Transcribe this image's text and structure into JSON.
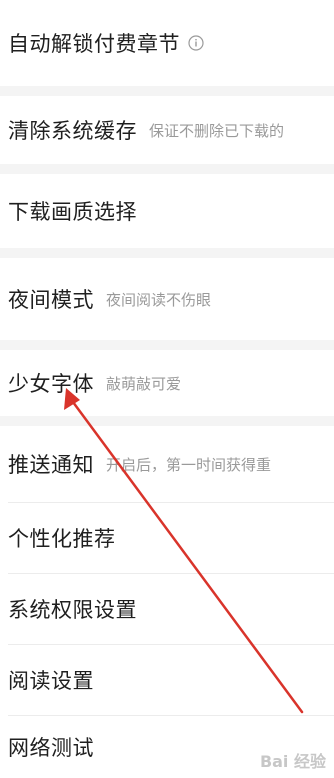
{
  "settings": {
    "items": [
      {
        "label": "自动解锁付费章节",
        "desc": "",
        "icon": "info-icon"
      },
      {
        "label": "清除系统缓存",
        "desc": "保证不删除已下载的"
      },
      {
        "label": "下载画质选择",
        "desc": ""
      },
      {
        "label": "夜间模式",
        "desc": "夜间阅读不伤眼"
      },
      {
        "label": "少女字体",
        "desc": "敲萌敲可爱"
      },
      {
        "label": "推送通知",
        "desc": "开启后，第一时间获得重"
      },
      {
        "label": "个性化推荐",
        "desc": ""
      },
      {
        "label": "系统权限设置",
        "desc": ""
      },
      {
        "label": "阅读设置",
        "desc": ""
      },
      {
        "label": "网络测试",
        "desc": ""
      }
    ]
  },
  "annotation": {
    "arrow_color": "#d9342b"
  },
  "watermark": {
    "text": "Bai 经验"
  }
}
